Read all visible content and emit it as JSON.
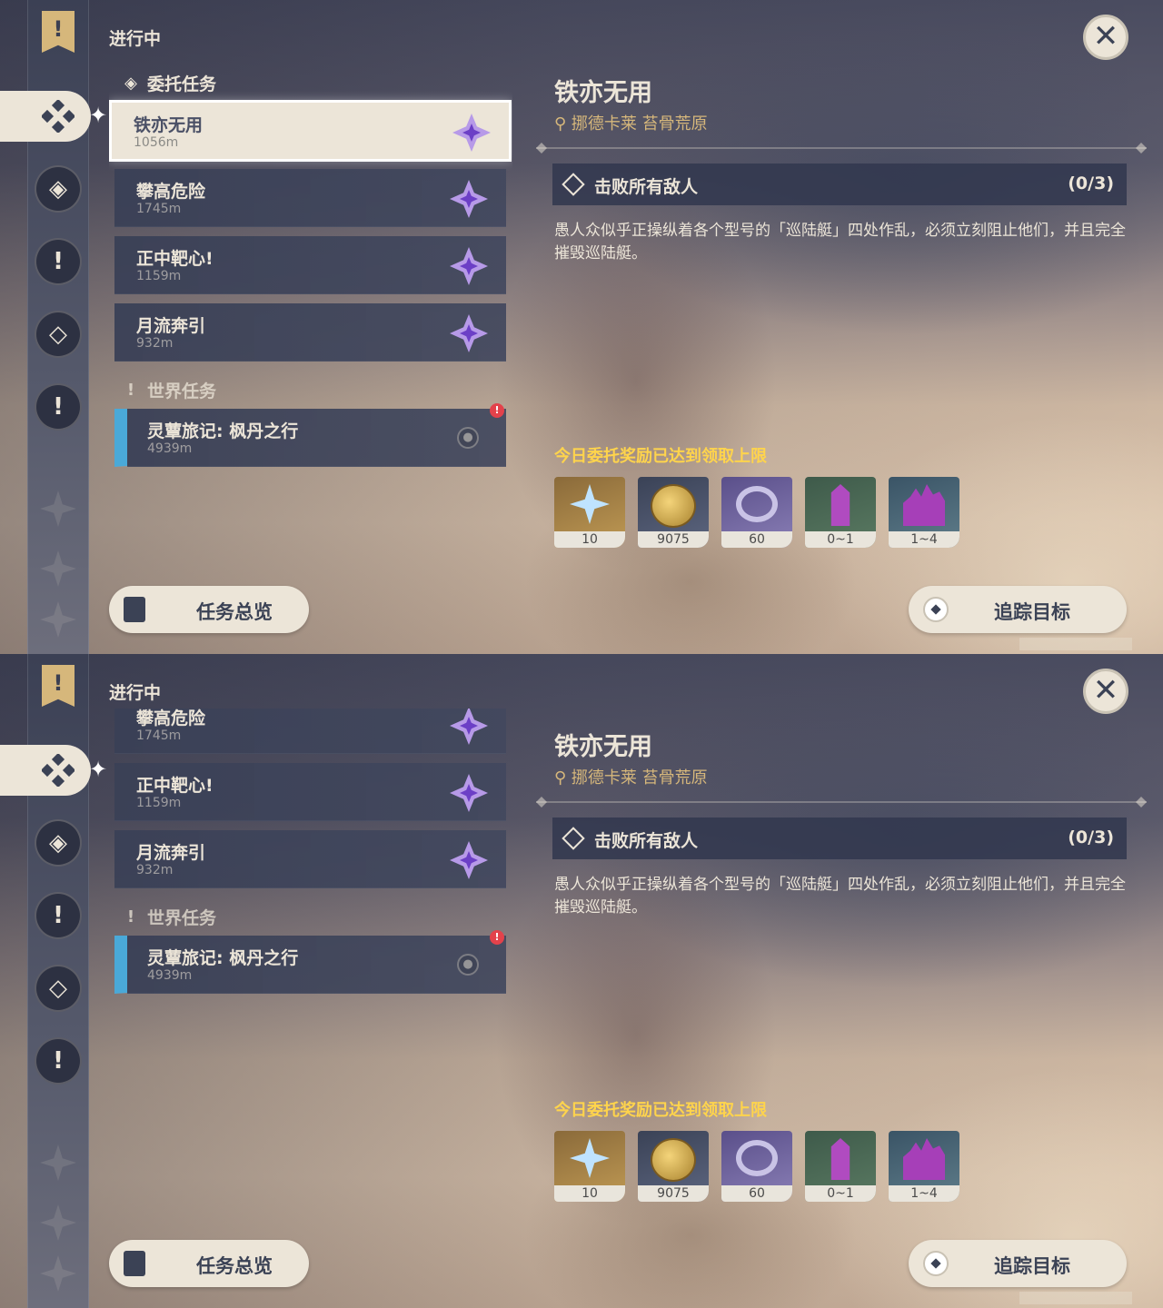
{
  "header": {
    "ongoing_label": "进行中",
    "close_label": "✕"
  },
  "sidebar": {
    "banner_glyph": "!",
    "icons": [
      "commission-icon",
      "archon-quest-icon",
      "story-quest-icon",
      "world-quest-icon",
      "world-quest-icon"
    ]
  },
  "sections": {
    "commission": "委托任务",
    "world": "世界任务"
  },
  "quests": [
    {
      "name": "铁亦无用",
      "distance": "1056m",
      "selected": true
    },
    {
      "name": "攀高危险",
      "distance": "1745m",
      "selected": false
    },
    {
      "name": "正中靶心!",
      "distance": "1159m",
      "selected": false
    },
    {
      "name": "月流奔引",
      "distance": "932m",
      "selected": false
    }
  ],
  "world_quests": [
    {
      "name": "灵蕈旅记: 枫丹之行",
      "distance": "4939m",
      "alert": "!"
    }
  ],
  "detail": {
    "title": "铁亦无用",
    "location": "挪德卡莱 苔骨荒原",
    "objective": "击败所有敌人",
    "progress": "(0/3)",
    "description": "愚人众似乎正操纵着各个型号的「巡陆艇」四处作乱，必须立刻阻止他们，并且完全摧毁巡陆艇。",
    "reward_note": "今日委托奖励已达到领取上限",
    "rewards": [
      {
        "icon": "primogem-icon",
        "count": "10"
      },
      {
        "icon": "mora-icon",
        "count": "9075"
      },
      {
        "icon": "companionship-exp-icon",
        "count": "60"
      },
      {
        "icon": "crystal-icon",
        "count": "0~1"
      },
      {
        "icon": "crystal-cluster-icon",
        "count": "1~4"
      }
    ]
  },
  "buttons": {
    "overview": "任务总览",
    "track": "追踪目标"
  },
  "colors": {
    "accent_gold": "#d6b77b",
    "reward_yellow": "#ffd44c",
    "world_blue": "#4aa9d8",
    "panel_cream": "#ece5d8"
  }
}
